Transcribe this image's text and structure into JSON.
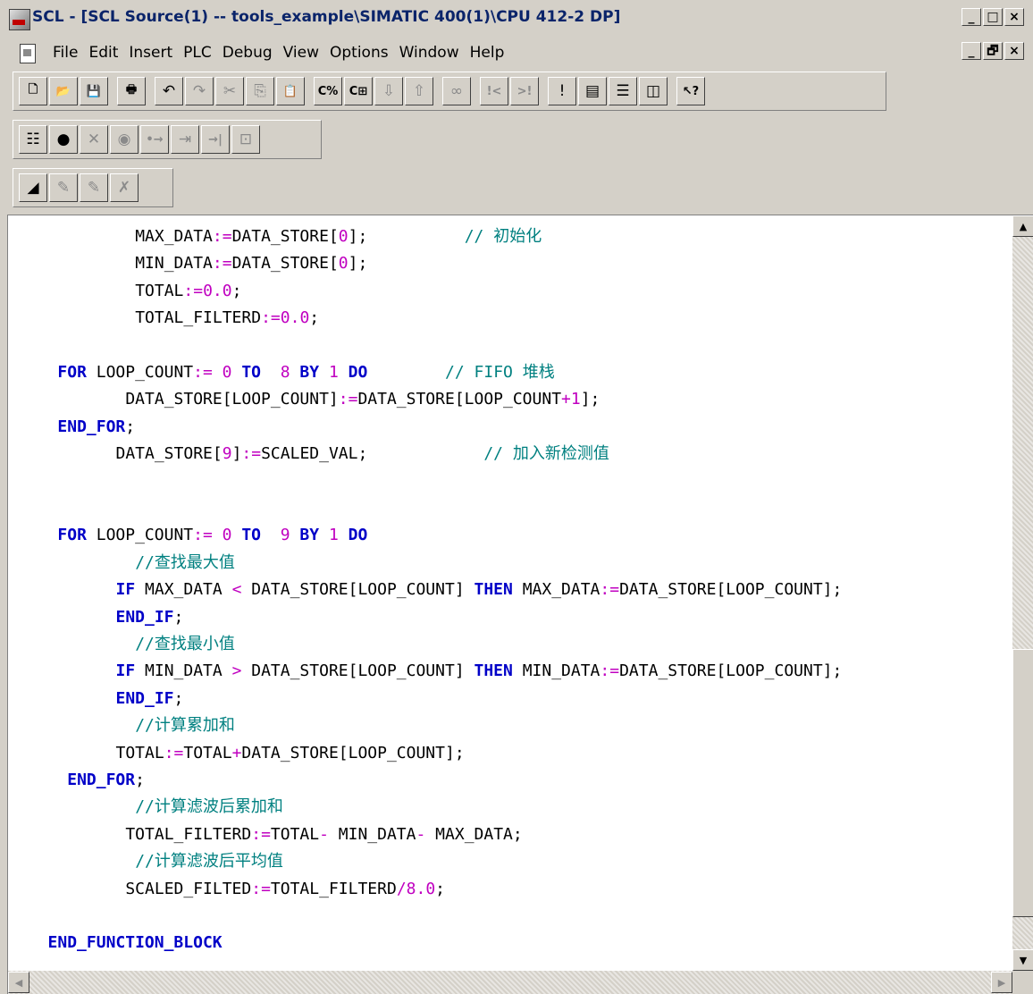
{
  "window": {
    "title": "SCL - [SCL Source(1) -- tools_example\\SIMATIC 400(1)\\CPU 412-2 DP]",
    "app_buttons": [
      "_",
      "□",
      "×"
    ],
    "doc_buttons": [
      "_",
      "🗗",
      "×"
    ]
  },
  "menu": {
    "items": [
      "File",
      "Edit",
      "Insert",
      "PLC",
      "Debug",
      "View",
      "Options",
      "Window",
      "Help"
    ]
  },
  "toolbars": {
    "row1": [
      {
        "icon": "new-icon",
        "glyph": "🗋"
      },
      {
        "icon": "open-icon",
        "glyph": "📂"
      },
      {
        "icon": "save-icon",
        "glyph": "💾"
      },
      {
        "sep": true
      },
      {
        "icon": "print-icon",
        "glyph": "🖶"
      },
      {
        "sep": true
      },
      {
        "icon": "undo-icon",
        "glyph": "↶"
      },
      {
        "icon": "redo-icon",
        "glyph": "↷",
        "dim": true
      },
      {
        "icon": "cut-icon",
        "glyph": "✂",
        "dim": true
      },
      {
        "icon": "copy-icon",
        "glyph": "⎘",
        "dim": true
      },
      {
        "icon": "paste-icon",
        "glyph": "📋"
      },
      {
        "sep": true
      },
      {
        "icon": "compile-icon",
        "glyph": "C%"
      },
      {
        "icon": "compile-all-icon",
        "glyph": "C⊞"
      },
      {
        "icon": "download-icon",
        "glyph": "⇩",
        "dim": true
      },
      {
        "icon": "upload-icon",
        "glyph": "⇧",
        "dim": true
      },
      {
        "sep": true
      },
      {
        "icon": "monitor-icon",
        "glyph": "∞",
        "dim": true
      },
      {
        "sep": true
      },
      {
        "icon": "go-to-first-error-icon",
        "glyph": "!<",
        "dim": true
      },
      {
        "icon": "go-to-next-error-icon",
        "glyph": ">!",
        "dim": true
      },
      {
        "sep": true
      },
      {
        "icon": "error-list-icon",
        "glyph": "!"
      },
      {
        "icon": "toggle-window-icon",
        "glyph": "▤"
      },
      {
        "icon": "split-horizontal-icon",
        "glyph": "☰"
      },
      {
        "icon": "split-vertical-icon",
        "glyph": "◫"
      },
      {
        "sep": true
      },
      {
        "icon": "context-help-icon",
        "glyph": "↖?"
      }
    ],
    "row2": [
      {
        "icon": "breakpoint-list-icon",
        "glyph": "☷"
      },
      {
        "icon": "set-breakpoint-icon",
        "glyph": "●"
      },
      {
        "icon": "delete-breakpoint-icon",
        "glyph": "✕",
        "dim": true
      },
      {
        "icon": "activate-breakpoint-icon",
        "glyph": "◉",
        "dim": true
      },
      {
        "icon": "next-statement-icon",
        "glyph": "•→",
        "dim": true
      },
      {
        "icon": "continue-icon",
        "glyph": "⇥",
        "dim": true
      },
      {
        "icon": "run-to-cursor-icon",
        "glyph": "→|",
        "dim": true
      },
      {
        "icon": "call-display-icon",
        "glyph": "⊡",
        "dim": true
      }
    ],
    "row3": [
      {
        "icon": "bookmark-toggle-icon",
        "glyph": "◢"
      },
      {
        "icon": "bookmark-next-icon",
        "glyph": "✎",
        "dim": true
      },
      {
        "icon": "bookmark-prev-icon",
        "glyph": "✎",
        "dim": true
      },
      {
        "icon": "bookmark-clear-icon",
        "glyph": "✗",
        "dim": true
      }
    ]
  },
  "code": {
    "lines": [
      {
        "indent": 12,
        "tokens": [
          [
            "text",
            "MAX_DATA"
          ],
          [
            "op",
            ":="
          ],
          [
            "text",
            "DATA_STORE["
          ],
          [
            "num",
            "0"
          ],
          [
            "text",
            "];          "
          ],
          [
            "comment",
            "// 初始化"
          ]
        ]
      },
      {
        "indent": 12,
        "tokens": [
          [
            "text",
            "MIN_DATA"
          ],
          [
            "op",
            ":="
          ],
          [
            "text",
            "DATA_STORE["
          ],
          [
            "num",
            "0"
          ],
          [
            "text",
            "];"
          ]
        ]
      },
      {
        "indent": 12,
        "tokens": [
          [
            "text",
            "TOTAL"
          ],
          [
            "op",
            ":="
          ],
          [
            "num",
            "0.0"
          ],
          [
            "text",
            ";"
          ]
        ]
      },
      {
        "indent": 12,
        "tokens": [
          [
            "text",
            "TOTAL_FILTERD"
          ],
          [
            "op",
            ":="
          ],
          [
            "num",
            "0.0"
          ],
          [
            "text",
            ";"
          ]
        ]
      },
      {
        "indent": 0,
        "tokens": []
      },
      {
        "indent": 4,
        "tokens": [
          [
            "kw",
            "FOR"
          ],
          [
            "text",
            " LOOP_COUNT"
          ],
          [
            "op",
            ":="
          ],
          [
            "text",
            " "
          ],
          [
            "num",
            "0"
          ],
          [
            "text",
            " "
          ],
          [
            "kw",
            "TO"
          ],
          [
            "text",
            "  "
          ],
          [
            "num",
            "8"
          ],
          [
            "text",
            " "
          ],
          [
            "kw",
            "BY"
          ],
          [
            "text",
            " "
          ],
          [
            "num",
            "1"
          ],
          [
            "text",
            " "
          ],
          [
            "kw",
            "DO"
          ],
          [
            "text",
            "        "
          ],
          [
            "comment",
            "// FIFO 堆栈"
          ]
        ]
      },
      {
        "indent": 11,
        "tokens": [
          [
            "text",
            "DATA_STORE[LOOP_COUNT]"
          ],
          [
            "op",
            ":="
          ],
          [
            "text",
            "DATA_STORE[LOOP_COUNT"
          ],
          [
            "op",
            "+"
          ],
          [
            "num",
            "1"
          ],
          [
            "text",
            "];"
          ]
        ]
      },
      {
        "indent": 4,
        "tokens": [
          [
            "kw",
            "END_FOR"
          ],
          [
            "text",
            ";"
          ]
        ]
      },
      {
        "indent": 10,
        "tokens": [
          [
            "text",
            "DATA_STORE["
          ],
          [
            "num",
            "9"
          ],
          [
            "text",
            "]"
          ],
          [
            "op",
            ":="
          ],
          [
            "text",
            "SCALED_VAL;            "
          ],
          [
            "comment",
            "// 加入新检测值"
          ]
        ]
      },
      {
        "indent": 0,
        "tokens": []
      },
      {
        "indent": 0,
        "tokens": []
      },
      {
        "indent": 4,
        "tokens": [
          [
            "kw",
            "FOR"
          ],
          [
            "text",
            " LOOP_COUNT"
          ],
          [
            "op",
            ":="
          ],
          [
            "text",
            " "
          ],
          [
            "num",
            "0"
          ],
          [
            "text",
            " "
          ],
          [
            "kw",
            "TO"
          ],
          [
            "text",
            "  "
          ],
          [
            "num",
            "9"
          ],
          [
            "text",
            " "
          ],
          [
            "kw",
            "BY"
          ],
          [
            "text",
            " "
          ],
          [
            "num",
            "1"
          ],
          [
            "text",
            " "
          ],
          [
            "kw",
            "DO"
          ]
        ]
      },
      {
        "indent": 12,
        "tokens": [
          [
            "comment",
            "//查找最大值"
          ]
        ]
      },
      {
        "indent": 10,
        "tokens": [
          [
            "kw",
            "IF"
          ],
          [
            "text",
            " MAX_DATA "
          ],
          [
            "op",
            "<"
          ],
          [
            "text",
            " DATA_STORE[LOOP_COUNT] "
          ],
          [
            "kw",
            "THEN"
          ],
          [
            "text",
            " MAX_DATA"
          ],
          [
            "op",
            ":="
          ],
          [
            "text",
            "DATA_STORE[LOOP_COUNT];"
          ]
        ]
      },
      {
        "indent": 10,
        "tokens": [
          [
            "kw",
            "END_IF"
          ],
          [
            "text",
            ";"
          ]
        ]
      },
      {
        "indent": 12,
        "tokens": [
          [
            "comment",
            "//查找最小值"
          ]
        ]
      },
      {
        "indent": 10,
        "tokens": [
          [
            "kw",
            "IF"
          ],
          [
            "text",
            " MIN_DATA "
          ],
          [
            "op",
            ">"
          ],
          [
            "text",
            " DATA_STORE[LOOP_COUNT] "
          ],
          [
            "kw",
            "THEN"
          ],
          [
            "text",
            " MIN_DATA"
          ],
          [
            "op",
            ":="
          ],
          [
            "text",
            "DATA_STORE[LOOP_COUNT];"
          ]
        ]
      },
      {
        "indent": 10,
        "tokens": [
          [
            "kw",
            "END_IF"
          ],
          [
            "text",
            ";"
          ]
        ]
      },
      {
        "indent": 12,
        "tokens": [
          [
            "comment",
            "//计算累加和"
          ]
        ]
      },
      {
        "indent": 10,
        "tokens": [
          [
            "text",
            "TOTAL"
          ],
          [
            "op",
            ":="
          ],
          [
            "text",
            "TOTAL"
          ],
          [
            "op",
            "+"
          ],
          [
            "text",
            "DATA_STORE[LOOP_COUNT];"
          ]
        ]
      },
      {
        "indent": 5,
        "tokens": [
          [
            "kw",
            "END_FOR"
          ],
          [
            "text",
            ";"
          ]
        ]
      },
      {
        "indent": 12,
        "tokens": [
          [
            "comment",
            "//计算滤波后累加和"
          ]
        ]
      },
      {
        "indent": 11,
        "tokens": [
          [
            "text",
            "TOTAL_FILTERD"
          ],
          [
            "op",
            ":="
          ],
          [
            "text",
            "TOTAL"
          ],
          [
            "op",
            "-"
          ],
          [
            "text",
            " MIN_DATA"
          ],
          [
            "op",
            "-"
          ],
          [
            "text",
            " MAX_DATA;"
          ]
        ]
      },
      {
        "indent": 12,
        "tokens": [
          [
            "comment",
            "//计算滤波后平均值"
          ]
        ]
      },
      {
        "indent": 11,
        "tokens": [
          [
            "text",
            "SCALED_FILTED"
          ],
          [
            "op",
            ":="
          ],
          [
            "text",
            "TOTAL_FILTERD"
          ],
          [
            "op",
            "/"
          ],
          [
            "num",
            "8.0"
          ],
          [
            "text",
            ";"
          ]
        ]
      },
      {
        "indent": 0,
        "tokens": []
      },
      {
        "indent": 3,
        "tokens": [
          [
            "kw",
            "END_FUNCTION_BLOCK"
          ]
        ]
      }
    ]
  }
}
